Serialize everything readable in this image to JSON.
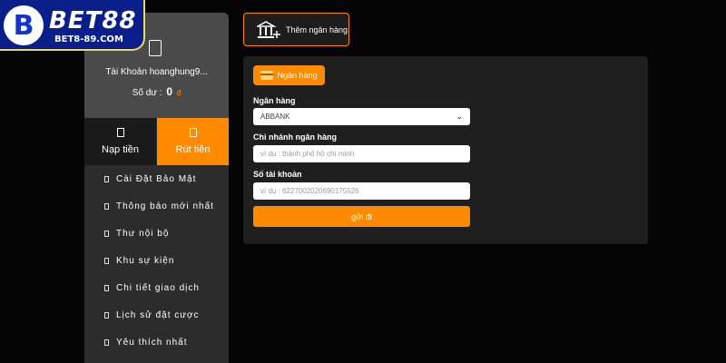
{
  "logo": {
    "mark": "B",
    "name": "BET88",
    "domain": "BET8-89.COM"
  },
  "account": {
    "name": "Tài Khoản hoanghung9...",
    "balance_label": "Số dư :",
    "balance_value": "0",
    "balance_unit": "đ"
  },
  "tabs": {
    "deposit": "Nạp tiền",
    "withdraw": "Rút tiền"
  },
  "menu": {
    "items": [
      {
        "label": "Cài Đặt Bảo Mật"
      },
      {
        "label": "Thông báo mới nhất"
      },
      {
        "label": "Thư nội bộ"
      },
      {
        "label": "Khu sự kiện"
      },
      {
        "label": "Chi tiết giao dịch"
      },
      {
        "label": "Lịch sử đặt cược"
      },
      {
        "label": "Yêu thích nhất"
      }
    ]
  },
  "add_bank": {
    "label": "Thêm ngân hàng"
  },
  "form": {
    "tab_label": "Ngân hàng",
    "bank_label": "Ngân hàng",
    "bank_value": "ABBANK",
    "branch_label": "Chi nhánh ngân hàng",
    "branch_placeholder": "ví dụ : thành phố hồ chí minh",
    "account_label": "Số tài khoản",
    "account_placeholder": "ví dụ : 6227002020690175526",
    "submit_label": "gửi đi"
  },
  "colors": {
    "accent": "#ff8a00",
    "sidebar": "#2c2c2c",
    "panel": "#1f1f1f",
    "logo_bg": "#0b1f8a"
  }
}
